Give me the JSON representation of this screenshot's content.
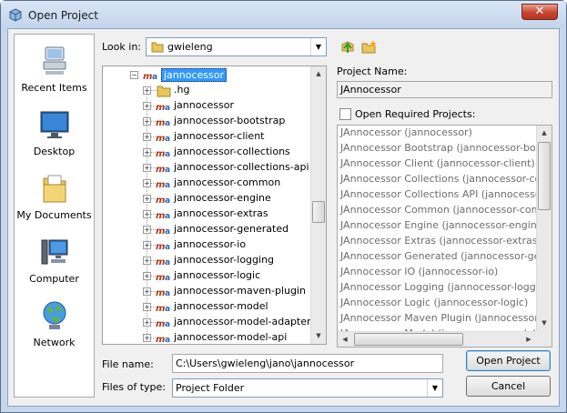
{
  "window": {
    "title": "Open Project",
    "close_symbol": "✕"
  },
  "places": [
    {
      "label": "Recent Items",
      "icon": "recent-items-icon"
    },
    {
      "label": "Desktop",
      "icon": "desktop-icon"
    },
    {
      "label": "My Documents",
      "icon": "my-documents-icon"
    },
    {
      "label": "Computer",
      "icon": "computer-icon"
    },
    {
      "label": "Network",
      "icon": "network-icon"
    }
  ],
  "look_in": {
    "label": "Look in:",
    "value": "gwieleng"
  },
  "tree": {
    "root": "jannocessor",
    "children": [
      ".hg",
      "jannocessor",
      "jannocessor-bootstrap",
      "jannocessor-client",
      "jannocessor-collections",
      "jannocessor-collections-api",
      "jannocessor-common",
      "jannocessor-engine",
      "jannocessor-extras",
      "jannocessor-generated",
      "jannocessor-io",
      "jannocessor-logging",
      "jannocessor-logic",
      "jannocessor-maven-plugin",
      "jannocessor-model",
      "jannocessor-model-adapter",
      "jannocessor-model-api"
    ]
  },
  "project_name": {
    "label": "Project Name:",
    "value": "JAnnocessor"
  },
  "required": {
    "label": "Open Required Projects:",
    "items": [
      "JAnnocessor (jannocessor)",
      "JAnnocessor Bootstrap (jannocessor-bootstr",
      "JAnnocessor Client (jannocessor-client)",
      "JAnnocessor Collections (jannocessor-collecti",
      "JAnnocessor Collections API (jannocessor-co",
      "JAnnocessor Common (jannocessor-common)",
      "JAnnocessor Engine (jannocessor-engine)",
      "JAnnocessor Extras (jannocessor-extras)",
      "JAnnocessor Generated (jannocessor-genera",
      "JAnnocessor IO (jannocessor-io)",
      "JAnnocessor Logging (jannocessor-logging)",
      "JAnnocessor Logic (jannocessor-logic)",
      "JAnnocessor Maven Plugin (jannocessor-mav",
      "JAnnocessor Model (jannocessor-model)"
    ]
  },
  "file_name": {
    "label": "File name:",
    "value": "C:\\Users\\gwieleng\\jano\\jannocessor"
  },
  "file_type": {
    "label": "Files of type:",
    "value": "Project Folder"
  },
  "buttons": {
    "open": "Open Project",
    "cancel": "Cancel"
  },
  "colors": {
    "selection": "#3399ff",
    "window_frame": "#c6d7ec",
    "default_button_border": "#3c7fb1"
  }
}
